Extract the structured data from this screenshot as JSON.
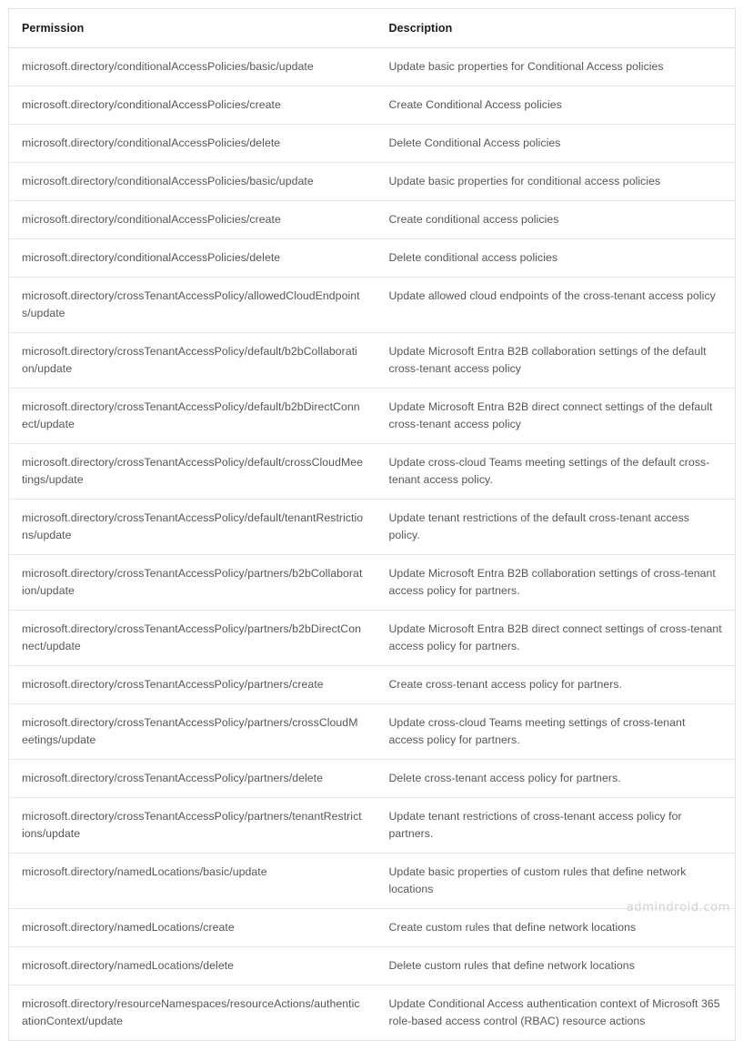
{
  "table": {
    "columns": [
      {
        "key": "permission",
        "label": "Permission"
      },
      {
        "key": "description",
        "label": "Description"
      }
    ],
    "rows": [
      {
        "permission": "microsoft.directory/conditionalAccessPolicies/basic/update",
        "description": "Update basic properties for Conditional Access policies"
      },
      {
        "permission": "microsoft.directory/conditionalAccessPolicies/create",
        "description": "Create Conditional Access policies"
      },
      {
        "permission": "microsoft.directory/conditionalAccessPolicies/delete",
        "description": "Delete Conditional Access policies"
      },
      {
        "permission": "microsoft.directory/conditionalAccessPolicies/basic/update",
        "description": "Update basic properties for conditional access policies"
      },
      {
        "permission": "microsoft.directory/conditionalAccessPolicies/create",
        "description": "Create conditional access policies"
      },
      {
        "permission": "microsoft.directory/conditionalAccessPolicies/delete",
        "description": "Delete conditional access policies"
      },
      {
        "permission": "microsoft.directory/crossTenantAccessPolicy/allowedCloudEndpoints/update",
        "description": "Update allowed cloud endpoints of the cross-tenant access policy"
      },
      {
        "permission": "microsoft.directory/crossTenantAccessPolicy/default/b2bCollaboration/update",
        "description": "Update Microsoft Entra B2B collaboration settings of the default cross-tenant access policy"
      },
      {
        "permission": "microsoft.directory/crossTenantAccessPolicy/default/b2bDirectConnect/update",
        "description": "Update Microsoft Entra B2B direct connect settings of the default cross-tenant access policy"
      },
      {
        "permission": "microsoft.directory/crossTenantAccessPolicy/default/crossCloudMeetings/update",
        "description": "Update cross-cloud Teams meeting settings of the default cross-tenant access policy."
      },
      {
        "permission": "microsoft.directory/crossTenantAccessPolicy/default/tenantRestrictions/update",
        "description": "Update tenant restrictions of the default cross-tenant access policy."
      },
      {
        "permission": "microsoft.directory/crossTenantAccessPolicy/partners/b2bCollaboration/update",
        "description": "Update Microsoft Entra B2B collaboration settings of cross-tenant access policy for partners."
      },
      {
        "permission": "microsoft.directory/crossTenantAccessPolicy/partners/b2bDirectConnect/update",
        "description": "Update Microsoft Entra B2B direct connect settings of cross-tenant access policy for partners."
      },
      {
        "permission": "microsoft.directory/crossTenantAccessPolicy/partners/create",
        "description": "Create cross-tenant access policy for partners."
      },
      {
        "permission": "microsoft.directory/crossTenantAccessPolicy/partners/crossCloudMeetings/update",
        "description": "Update cross-cloud Teams meeting settings of cross-tenant access policy for partners."
      },
      {
        "permission": "microsoft.directory/crossTenantAccessPolicy/partners/delete",
        "description": "Delete cross-tenant access policy for partners."
      },
      {
        "permission": "microsoft.directory/crossTenantAccessPolicy/partners/tenantRestrictions/update",
        "description": "Update tenant restrictions of cross-tenant access policy for partners."
      },
      {
        "permission": "microsoft.directory/namedLocations/basic/update",
        "description": "Update basic properties of custom rules that define network locations"
      },
      {
        "permission": "microsoft.directory/namedLocations/create",
        "description": "Create custom rules that define network locations"
      },
      {
        "permission": "microsoft.directory/namedLocations/delete",
        "description": "Delete custom rules that define network locations"
      },
      {
        "permission": "microsoft.directory/resourceNamespaces/resourceActions/authenticationContext/update",
        "description": "Update Conditional Access authentication context of Microsoft 365 role-based access control (RBAC) resource actions"
      }
    ]
  },
  "watermark": {
    "text": "admindroid.com"
  }
}
